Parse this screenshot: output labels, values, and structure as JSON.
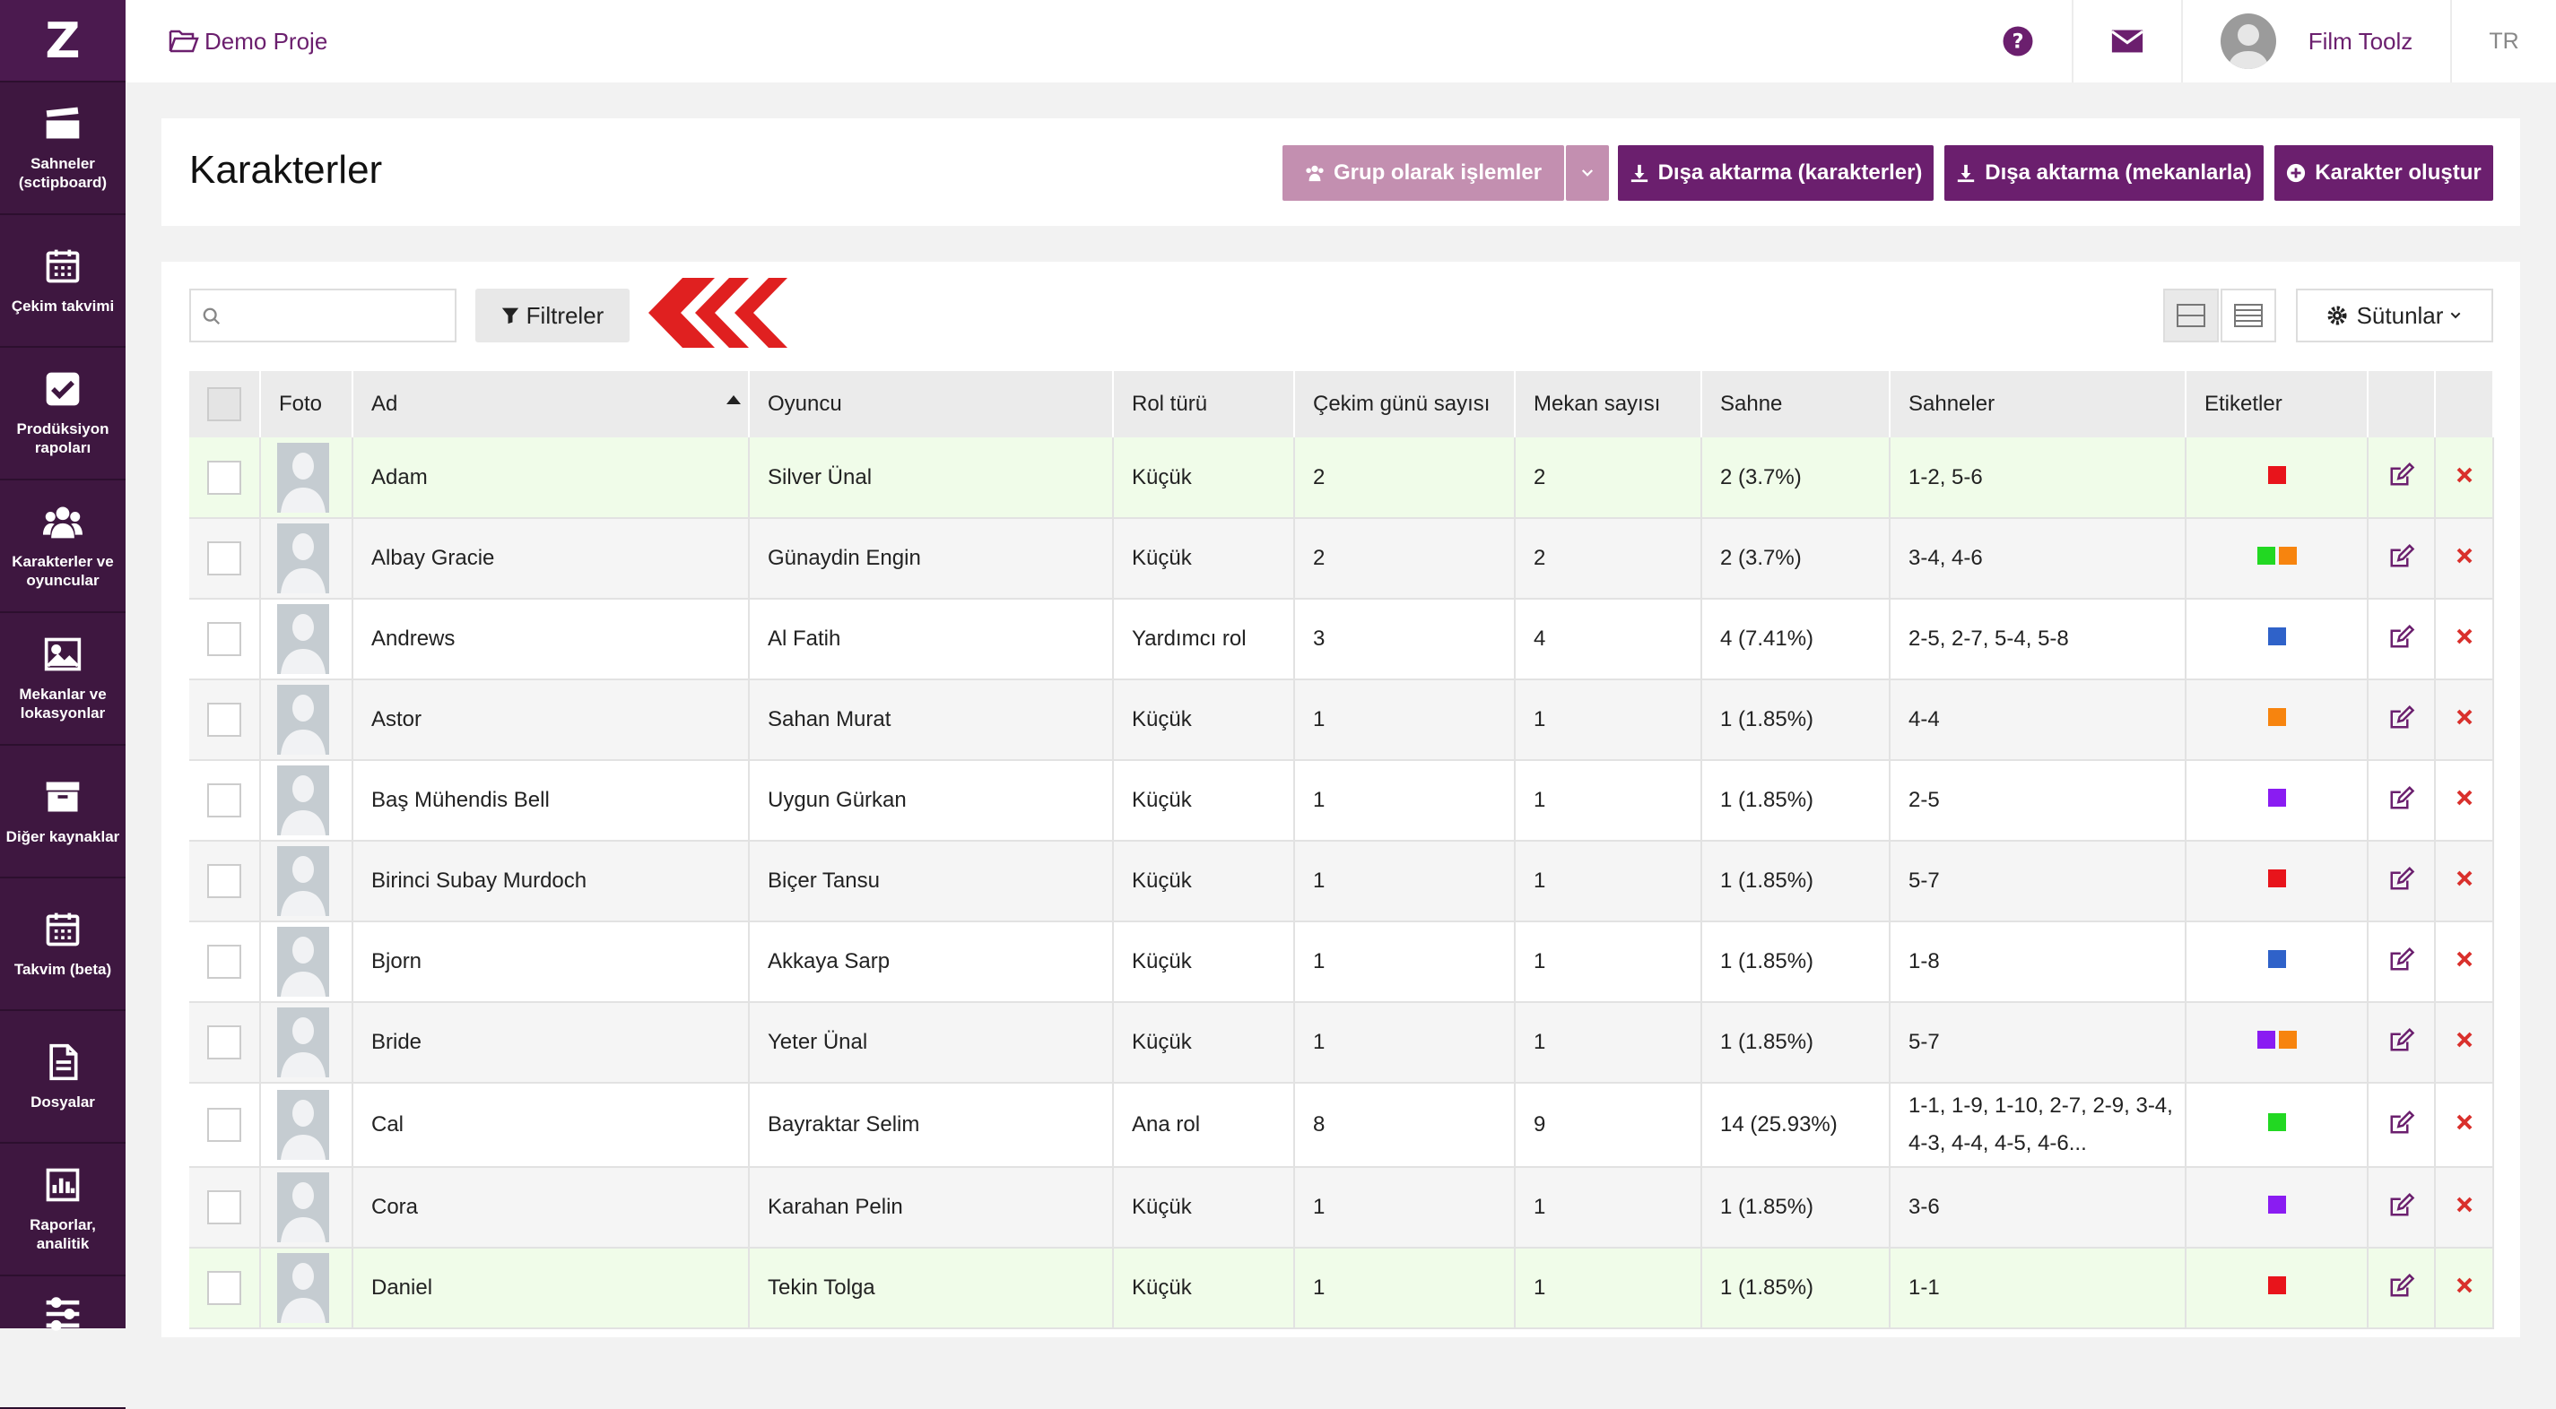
{
  "header": {
    "project": "Demo Proje",
    "user": "Film Toolz",
    "lang": "TR"
  },
  "sidebar": {
    "logo": "Z",
    "items": [
      {
        "label": "Sahneler (sctipboard)",
        "icon": "clapperboard-icon"
      },
      {
        "label": "Çekim takvimi",
        "icon": "calendar-icon"
      },
      {
        "label": "Prodüksiyon rapoları",
        "icon": "checkbox-icon"
      },
      {
        "label": "Karakterler ve oyuncular",
        "icon": "users-icon"
      },
      {
        "label": "Mekanlar ve lokasyonlar",
        "icon": "image-icon"
      },
      {
        "label": "Diğer kaynaklar",
        "icon": "archive-icon"
      },
      {
        "label": "Takvim (beta)",
        "icon": "calendar-grid-icon"
      },
      {
        "label": "Dosyalar",
        "icon": "file-icon"
      },
      {
        "label": "Raporlar, analitik",
        "icon": "bar-chart-icon"
      },
      {
        "label": "",
        "icon": "sliders-icon"
      }
    ]
  },
  "page": {
    "title": "Karakterler"
  },
  "toolbar": {
    "group": "Grup olarak işlemler",
    "export_chars": "Dışa aktarma (karakterler)",
    "export_locs": "Dışa aktarma (mekanlarla)",
    "create": "Karakter oluştur",
    "filters": "Filtreler",
    "columns": "Sütunlar",
    "search_placeholder": ""
  },
  "colors": {
    "accent": "#6b1f6e",
    "sidebar": "#3e1740",
    "group_btn": "#c38fb0",
    "red_arrow": "#e02020",
    "delete": "#d9302c"
  },
  "table": {
    "headers": [
      "",
      "Foto",
      "Ad",
      "Oyuncu",
      "Rol türü",
      "Çekim günü sayısı",
      "Mekan sayısı",
      "Sahne",
      "Sahneler",
      "Etiketler",
      "",
      ""
    ],
    "rows": [
      {
        "ad": "Adam",
        "oyuncu": "Silver Ünal",
        "rol": "Küçük",
        "cekim": "2",
        "mekan": "2",
        "sahne": "2 (3.7%)",
        "sahneler": "1-2, 5-6",
        "tags": [
          "#e8141b"
        ],
        "style": "green"
      },
      {
        "ad": "Albay Gracie",
        "oyuncu": "Günaydin Engin",
        "rol": "Küçük",
        "cekim": "2",
        "mekan": "2",
        "sahne": "2 (3.7%)",
        "sahneler": "3-4, 4-6",
        "tags": [
          "#22d822",
          "#f7840e"
        ],
        "style": "grey"
      },
      {
        "ad": "Andrews",
        "oyuncu": "Al Fatih",
        "rol": "Yardımcı rol",
        "cekim": "3",
        "mekan": "4",
        "sahne": "4 (7.41%)",
        "sahneler": "2-5, 2-7, 5-4, 5-8",
        "tags": [
          "#2f62c9"
        ],
        "style": "white"
      },
      {
        "ad": "Astor",
        "oyuncu": "Sahan Murat",
        "rol": "Küçük",
        "cekim": "1",
        "mekan": "1",
        "sahne": "1 (1.85%)",
        "sahneler": "4-4",
        "tags": [
          "#f7840e"
        ],
        "style": "grey"
      },
      {
        "ad": "Baş Mühendis Bell",
        "oyuncu": "Uygun Gürkan",
        "rol": "Küçük",
        "cekim": "1",
        "mekan": "1",
        "sahne": "1 (1.85%)",
        "sahneler": "2-5",
        "tags": [
          "#8a1cf2"
        ],
        "style": "white"
      },
      {
        "ad": "Birinci Subay Murdoch",
        "oyuncu": "Biçer Tansu",
        "rol": "Küçük",
        "cekim": "1",
        "mekan": "1",
        "sahne": "1 (1.85%)",
        "sahneler": "5-7",
        "tags": [
          "#e8141b"
        ],
        "style": "grey"
      },
      {
        "ad": "Bjorn",
        "oyuncu": "Akkaya Sarp",
        "rol": "Küçük",
        "cekim": "1",
        "mekan": "1",
        "sahne": "1 (1.85%)",
        "sahneler": "1-8",
        "tags": [
          "#2f62c9"
        ],
        "style": "white"
      },
      {
        "ad": "Bride",
        "oyuncu": "Yeter Ünal",
        "rol": "Küçük",
        "cekim": "1",
        "mekan": "1",
        "sahne": "1 (1.85%)",
        "sahneler": "5-7",
        "tags": [
          "#8a1cf2",
          "#f7840e"
        ],
        "style": "grey"
      },
      {
        "ad": "Cal",
        "oyuncu": "Bayraktar Selim",
        "rol": "Ana rol",
        "cekim": "8",
        "mekan": "9",
        "sahne": "14 (25.93%)",
        "sahneler": "1-1, 1-9, 1-10, 2-7, 2-9, 3-4, 4-3, 4-4, 4-5, 4-6...",
        "tags": [
          "#22d822"
        ],
        "style": "white"
      },
      {
        "ad": "Cora",
        "oyuncu": "Karahan Pelin",
        "rol": "Küçük",
        "cekim": "1",
        "mekan": "1",
        "sahne": "1 (1.85%)",
        "sahneler": "3-6",
        "tags": [
          "#8a1cf2"
        ],
        "style": "grey"
      },
      {
        "ad": "Daniel",
        "oyuncu": "Tekin Tolga",
        "rol": "Küçük",
        "cekim": "1",
        "mekan": "1",
        "sahne": "1 (1.85%)",
        "sahneler": "1-1",
        "tags": [
          "#e8141b"
        ],
        "style": "green"
      }
    ]
  }
}
